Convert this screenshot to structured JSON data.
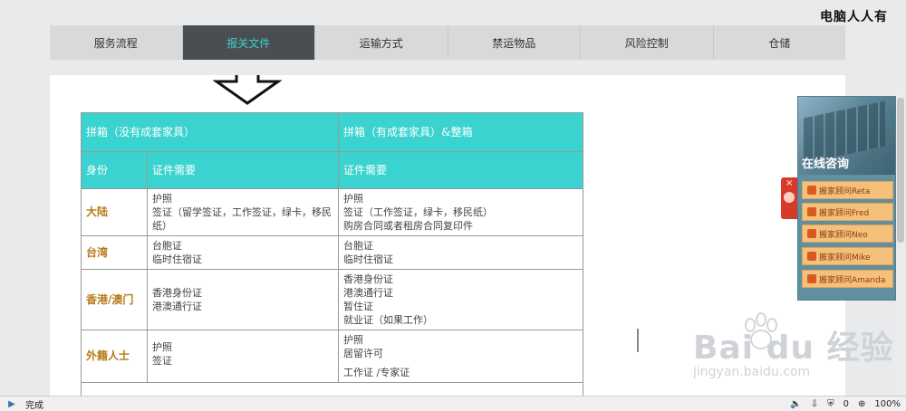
{
  "watermark_top": "电脑人人有",
  "nav": {
    "tabs": [
      "服务流程",
      "报关文件",
      "运输方式",
      "禁运物品",
      "风险控制",
      "仓储"
    ],
    "active_index": 1
  },
  "table": {
    "header1": {
      "left": "拼箱（没有成套家具）",
      "right": "拼箱（有成套家具）&整箱"
    },
    "header2": {
      "identity": "身份",
      "docs_left": "证件需要",
      "docs_right": "证件需要"
    },
    "rows": [
      {
        "label": "大陆",
        "left": [
          "护照",
          "签证（留学签证，工作签证，绿卡，移民纸）"
        ],
        "right": [
          "护照",
          "签证（工作签证，绿卡，移民纸）",
          "购房合同或者租房合同复印件"
        ]
      },
      {
        "label": "台湾",
        "left": [
          "台胞证",
          "临时住宿证"
        ],
        "right": [
          "台胞证",
          "临时住宿证"
        ]
      },
      {
        "label": "香港/澳门",
        "left": [
          "香港身份证",
          "港澳通行证"
        ],
        "right": [
          "香港身份证",
          "港澳通行证",
          "暂住证",
          "就业证（如果工作）"
        ]
      },
      {
        "label": "外籍人士",
        "left": [
          "护照",
          "签证"
        ],
        "right": [
          "护照",
          "居留许可",
          "工作证 /专家证"
        ]
      }
    ]
  },
  "chat": {
    "title": "在线咨询",
    "close_label": "×",
    "advisors": [
      "搬家顾问Reta",
      "搬家顾问Fred",
      "搬家顾问Neo",
      "搬家顾问Mike",
      "搬家顾问Amanda"
    ]
  },
  "baidu": {
    "logo": "Bai du 经验",
    "url": "jingyan.baidu.com"
  },
  "statusbar": {
    "status": "完成",
    "count": "0",
    "zoom": "100%"
  }
}
